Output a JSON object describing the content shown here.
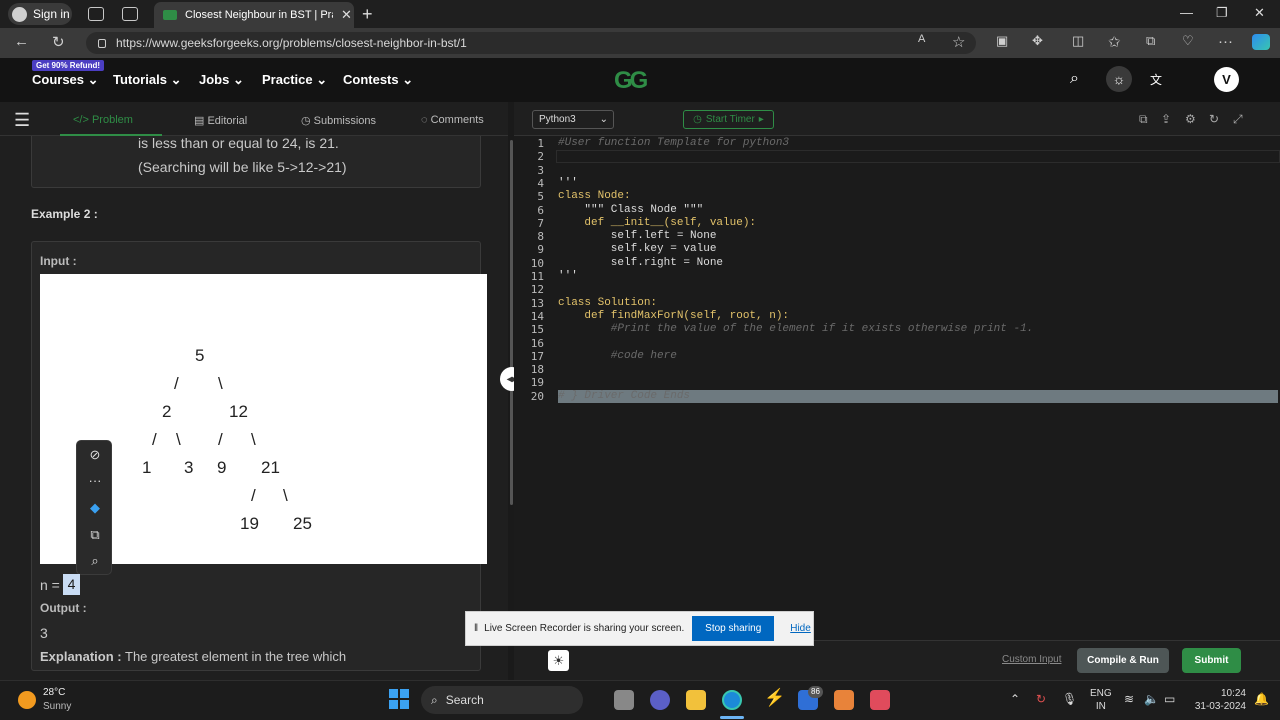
{
  "browser": {
    "signin_label": "Sign in",
    "tab_title": "Closest Neighbour in BST | Practi",
    "url": "https://www.geeksforgeeks.org/problems/closest-neighbor-in-bst/1"
  },
  "site_header": {
    "promo_badge": "Get 90% Refund!",
    "nav": [
      "Courses",
      "Tutorials",
      "Jobs",
      "Practice",
      "Contests"
    ],
    "logo_text": "GG",
    "avatar_letter": "V"
  },
  "problem_tabs": {
    "problem": "Problem",
    "editorial": "Editorial",
    "submissions": "Submissions",
    "comments": "Comments"
  },
  "problem": {
    "prev_explanation_line1": "is less than or equal to 24, is 21.",
    "prev_explanation_line2": "(Searching will be like 5->12->21)",
    "example2_heading": "Example 2 :",
    "input_label": "Input :",
    "tree_nodes": [
      "5",
      "/",
      "\\",
      "2",
      "12",
      "/",
      "\\",
      "/",
      "\\",
      "1",
      "3",
      "9",
      "21",
      "/",
      "\\",
      "19",
      "25"
    ],
    "n_prefix": "n = ",
    "n_value": "4",
    "output_label": "Output :",
    "output_value": "3",
    "explanation_label": "Explanation :",
    "explanation_text": "The greatest element in the tree which"
  },
  "mini_toolbar": {
    "icons": [
      "hide-eye-icon",
      "more-icon",
      "copilot-icon",
      "copy-icon",
      "search-icon"
    ]
  },
  "editor": {
    "language": "Python3",
    "timer_label": "Start Timer",
    "lines": [
      "#User function Template for python3",
      "",
      "",
      "'''",
      "class Node:",
      "    \"\"\" Class Node \"\"\"",
      "    def __init__(self, value):",
      "        self.left = None",
      "        self.key = value",
      "        self.right = None",
      "'''",
      "",
      "class Solution:",
      "    def findMaxForN(self, root, n):",
      "        #Print the value of the element if it exists otherwise print -1.",
      "",
      "        #code here",
      "",
      "",
      "# } Driver Code Ends"
    ],
    "custom_input": "Custom Input",
    "compile_label": "Compile & Run",
    "submit_label": "Submit"
  },
  "share_bar": {
    "message": "Live Screen Recorder is sharing your screen.",
    "stop_label": "Stop sharing",
    "hide_label": "Hide"
  },
  "taskbar": {
    "temp": "28°C",
    "weather": "Sunny",
    "search_label": "Search",
    "badge_count": "86",
    "lang_line1": "ENG",
    "lang_line2": "IN",
    "time": "10:24",
    "date": "31-03-2024"
  }
}
